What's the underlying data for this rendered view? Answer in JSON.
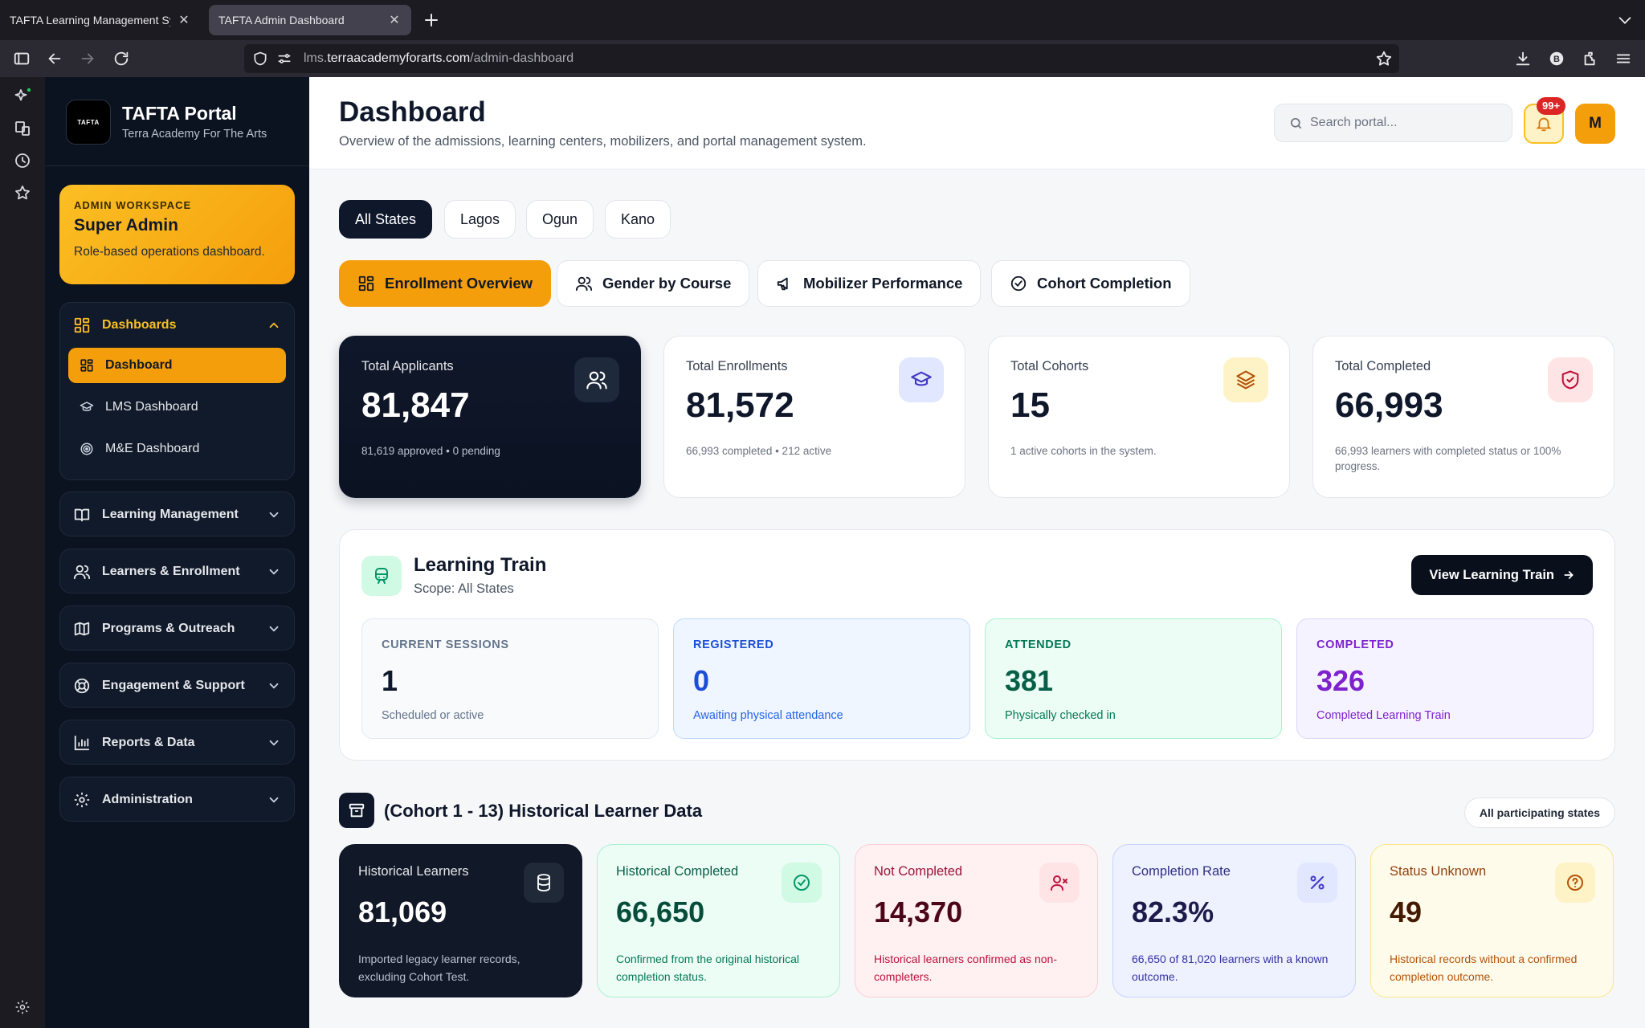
{
  "browser": {
    "tabs": [
      {
        "label": "TAFTA Learning Management System",
        "active": false
      },
      {
        "label": "TAFTA Admin Dashboard",
        "active": true
      }
    ],
    "url_prefix": "lms.",
    "url_domain": "terraacademyforarts.com",
    "url_path": "/admin-dashboard",
    "profile_letter": "B"
  },
  "sidebar": {
    "logo_text": "TAFTA",
    "brand_title": "TAFTA Portal",
    "brand_sub": "Terra Academy For The Arts",
    "workspace": {
      "eyebrow": "ADMIN WORKSPACE",
      "title": "Super Admin",
      "desc": "Role-based operations dashboard."
    },
    "groups": [
      {
        "label": "Dashboards",
        "open": true,
        "items": [
          {
            "label": "Dashboard",
            "active": true
          },
          {
            "label": "LMS Dashboard",
            "active": false
          },
          {
            "label": "M&E Dashboard",
            "active": false
          }
        ]
      },
      {
        "label": "Learning Management",
        "open": false
      },
      {
        "label": "Learners & Enrollment",
        "open": false
      },
      {
        "label": "Programs & Outreach",
        "open": false
      },
      {
        "label": "Engagement & Support",
        "open": false
      },
      {
        "label": "Reports & Data",
        "open": false
      },
      {
        "label": "Administration",
        "open": false
      }
    ]
  },
  "header": {
    "title": "Dashboard",
    "subtitle": "Overview of the admissions, learning centers, mobilizers, and portal management system.",
    "search_placeholder": "Search portal...",
    "notif_badge": "99+",
    "avatar_letter": "M"
  },
  "state_filters": [
    "All States",
    "Lagos",
    "Ogun",
    "Kano"
  ],
  "active_state": "All States",
  "view_tabs": [
    "Enrollment Overview",
    "Gender by Course",
    "Mobilizer Performance",
    "Cohort Completion"
  ],
  "active_view": "Enrollment Overview",
  "stats": [
    {
      "label": "Total Applicants",
      "value": "81,847",
      "desc": "81,619 approved • 0 pending"
    },
    {
      "label": "Total Enrollments",
      "value": "81,572",
      "desc": "66,993 completed • 212 active"
    },
    {
      "label": "Total Cohorts",
      "value": "15",
      "desc": "1 active cohorts in the system."
    },
    {
      "label": "Total Completed",
      "value": "66,993",
      "desc": "66,993 learners with completed status or 100% progress."
    }
  ],
  "learning_train": {
    "title": "Learning Train",
    "scope": "Scope: All States",
    "button": "View Learning Train",
    "cards": [
      {
        "label": "CURRENT SESSIONS",
        "value": "1",
        "desc": "Scheduled or active"
      },
      {
        "label": "REGISTERED",
        "value": "0",
        "desc": "Awaiting physical attendance"
      },
      {
        "label": "ATTENDED",
        "value": "381",
        "desc": "Physically checked in"
      },
      {
        "label": "COMPLETED",
        "value": "326",
        "desc": "Completed Learning Train"
      }
    ]
  },
  "historical": {
    "title": "(Cohort 1 - 13) Historical Learner Data",
    "chip": "All participating states",
    "cards": [
      {
        "label": "Historical Learners",
        "value": "81,069",
        "desc": "Imported legacy learner records, excluding Cohort Test."
      },
      {
        "label": "Historical Completed",
        "value": "66,650",
        "desc": "Confirmed from the original historical completion status."
      },
      {
        "label": "Not Completed",
        "value": "14,370",
        "desc": "Historical learners confirmed as non-completers."
      },
      {
        "label": "Completion Rate",
        "value": "82.3%",
        "desc": "66,650 of 81,020 learners with a known outcome."
      },
      {
        "label": "Status Unknown",
        "value": "49",
        "desc": "Historical records without a confirmed completion outcome."
      }
    ]
  },
  "colors": {
    "accent": "#f59e0b",
    "sidebar_bg": "#0b1220",
    "dark_card": "#0f172a"
  }
}
